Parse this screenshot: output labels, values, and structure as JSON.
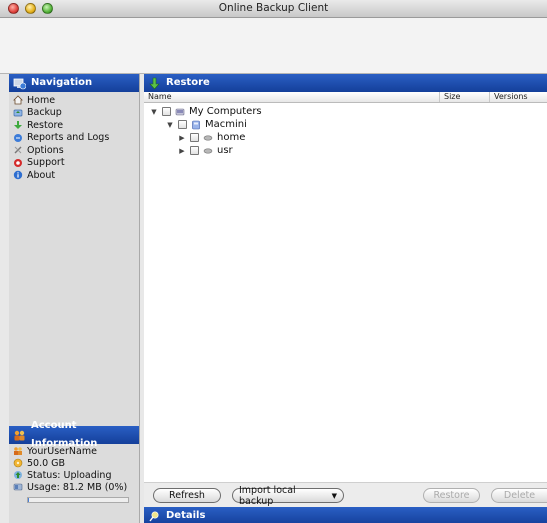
{
  "window": {
    "title": "Online Backup Client"
  },
  "sidebar": {
    "header": "Navigation",
    "items": [
      {
        "label": "Home",
        "icon": "home-icon"
      },
      {
        "label": "Backup",
        "icon": "backup-icon"
      },
      {
        "label": "Restore",
        "icon": "restore-icon"
      },
      {
        "label": "Reports and Logs",
        "icon": "reports-icon"
      },
      {
        "label": "Options",
        "icon": "options-icon"
      },
      {
        "label": "Support",
        "icon": "support-icon"
      },
      {
        "label": "About",
        "icon": "info-icon"
      }
    ],
    "account": {
      "header": "Account Information",
      "username": "YourUserName",
      "quota": "50.0 GB",
      "status": "Status: Uploading",
      "usage": "Usage: 81.2 MB (0%)",
      "usage_fraction": 0.002
    }
  },
  "main": {
    "header": "Restore",
    "columns": {
      "name": "Name",
      "size": "Size",
      "versions": "Versions"
    },
    "tree": [
      {
        "label": "My Computers",
        "level": 0,
        "expanded": true
      },
      {
        "label": "Macmini",
        "level": 1,
        "expanded": true
      },
      {
        "label": "home",
        "level": 2,
        "expanded": false
      },
      {
        "label": "usr",
        "level": 2,
        "expanded": false
      }
    ],
    "buttons": {
      "refresh": "Refresh",
      "import": "Import local backup",
      "restore": "Restore",
      "delete": "Delete"
    },
    "details_header": "Details"
  }
}
